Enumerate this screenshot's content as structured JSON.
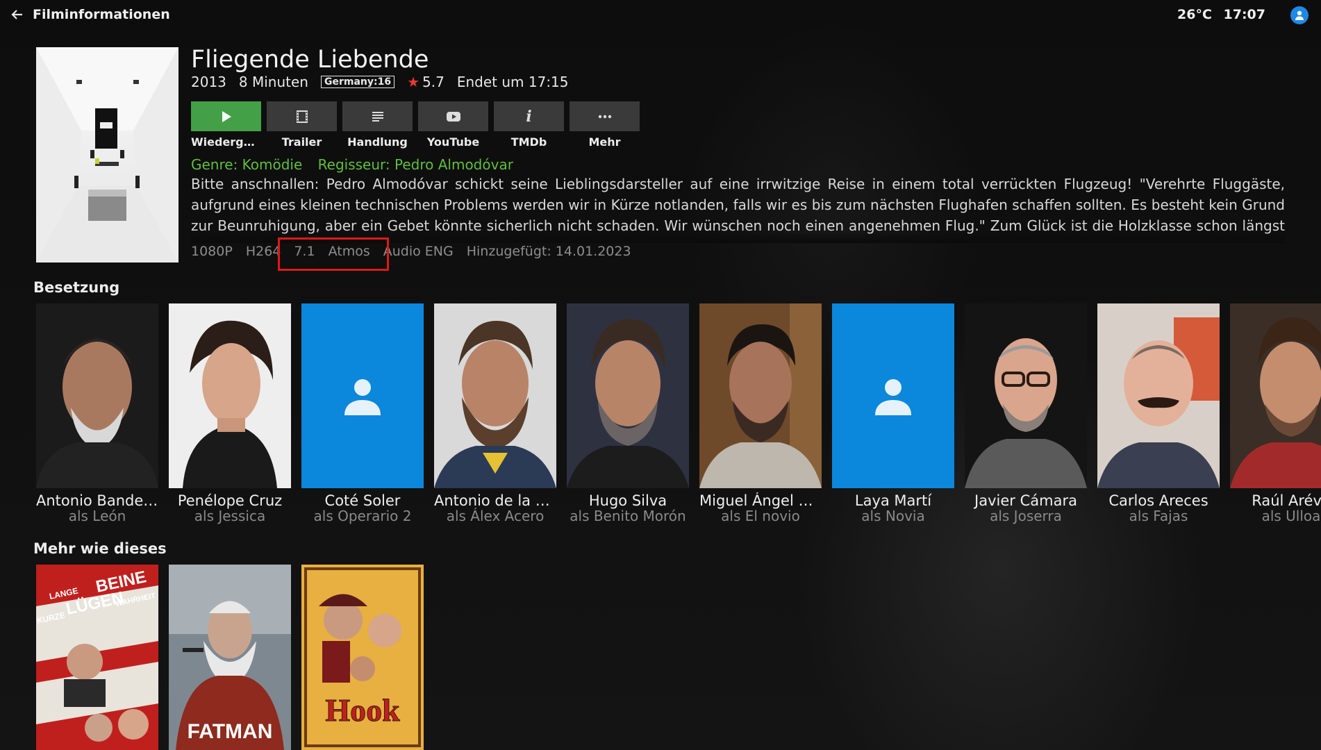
{
  "topbar": {
    "title": "Filminformationen",
    "temperature": "26°C",
    "time": "17:07"
  },
  "movie": {
    "title": "Fliegende Liebende",
    "year": "2013",
    "duration": "8 Minuten",
    "age_rating": "Germany:16",
    "rating": "5.7",
    "ends_at": "Endet um 17:15",
    "genre": "Genre: Komödie",
    "director": "Regisseur: Pedro Almodóvar",
    "plot": "Bitte anschnallen: Pedro Almodóvar schickt seine Lieblingsdarsteller auf eine irrwitzige Reise in einem total verrückten Flugzeug!  \"Verehrte Fluggäste, aufgrund eines kleinen technischen Problems werden wir in Kürze notlanden, falls wir es bis zum nächsten Flughafen schaffen sollten. Es besteht kein Grund zur Beunruhigung, aber ein Gebet könnte sicherlich nicht schaden. Wir wünschen noch einen angenehmen Flug.\" Zum Glück ist die Holzklasse schon längst im Land der Träume, der Chef-Steward greift Schlaftabletten. Sogar Co-Pilot und Passagiere … Der Business-Class bieten zwischen Marke…",
    "tech": {
      "resolution": "1080P",
      "codec": "H264",
      "channels": "7.1",
      "audio_format": "Atmos",
      "audio_lang": "Audio ENG",
      "added": "Hinzugefügt: 14.01.2023"
    }
  },
  "actions": [
    {
      "label": "Wiedergeb...",
      "icon": "play-icon"
    },
    {
      "label": "Trailer",
      "icon": "film-icon"
    },
    {
      "label": "Handlung",
      "icon": "text-lines-icon"
    },
    {
      "label": "YouTube",
      "icon": "youtube-icon"
    },
    {
      "label": "TMDb",
      "icon": "info-icon"
    },
    {
      "label": "Mehr",
      "icon": "more-dots-icon"
    }
  ],
  "cast_section": {
    "title": "Besetzung",
    "members": [
      {
        "name": "Antonio Bander...",
        "role": "als León",
        "photo": "portrait"
      },
      {
        "name": "Penélope Cruz",
        "role": "als Jessica",
        "photo": "portrait"
      },
      {
        "name": "Coté Soler",
        "role": "als Operario 2",
        "photo": "placeholder"
      },
      {
        "name": "Antonio de la T...",
        "role": "als Álex Acero",
        "photo": "portrait"
      },
      {
        "name": "Hugo Silva",
        "role": "als Benito Morón",
        "photo": "portrait"
      },
      {
        "name": "Miguel Ángel Si...",
        "role": "als El novio",
        "photo": "portrait"
      },
      {
        "name": "Laya Martí",
        "role": "als Novia",
        "photo": "placeholder"
      },
      {
        "name": "Javier Cámara",
        "role": "als Joserra",
        "photo": "portrait"
      },
      {
        "name": "Carlos Areces",
        "role": "als Fajas",
        "photo": "portrait"
      },
      {
        "name": "Raúl Aréva",
        "role": "als Ulloa",
        "photo": "portrait"
      }
    ]
  },
  "more_section": {
    "title": "Mehr wie dieses",
    "items": [
      {
        "poster_text_1": "LANGE",
        "poster_text_2": "BEINE",
        "poster_text_3": "KURZE",
        "poster_text_4": "LÜGEN",
        "poster_text_5": "WAHRHEIT"
      },
      {
        "poster_text_1": "FATMAN"
      },
      {
        "poster_text_1": "Hook"
      }
    ]
  },
  "colors": {
    "accent_green": "#43a047",
    "genre_green": "#5fbf3a",
    "profile_blue": "#1e88e5",
    "placeholder_blue": "#0b87dc",
    "highlight_red": "#e01818",
    "star_red": "#e53935"
  }
}
